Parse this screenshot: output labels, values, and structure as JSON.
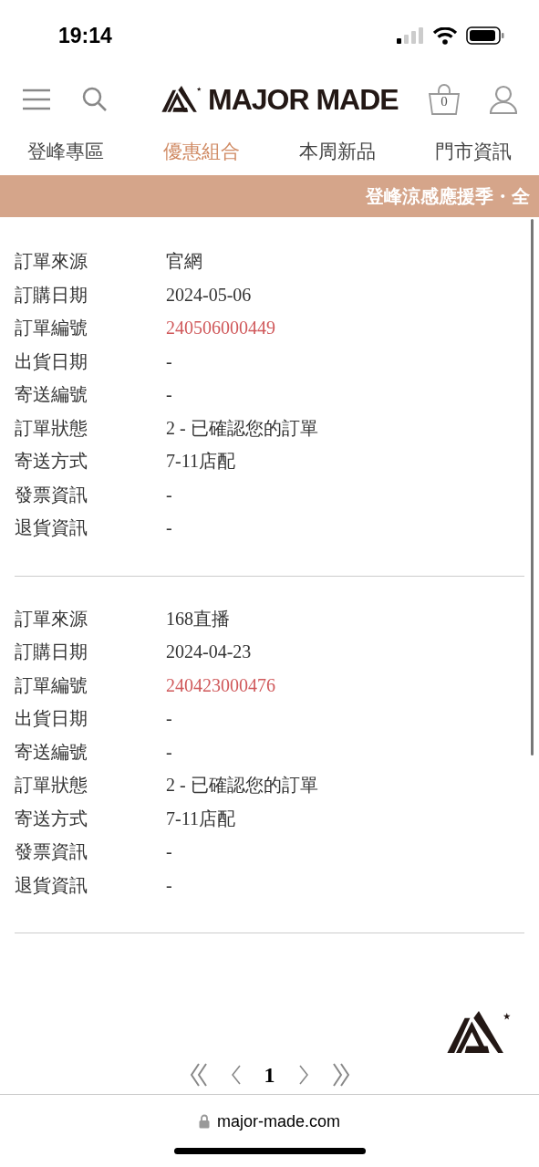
{
  "status_bar": {
    "time": "19:14"
  },
  "header": {
    "logo_text": "MAJOR MADE",
    "cart_count": "0"
  },
  "tabs": [
    {
      "label": "登峰專區",
      "selected": false
    },
    {
      "label": "優惠組合",
      "selected": true
    },
    {
      "label": "本周新品",
      "selected": false
    },
    {
      "label": "門市資訊",
      "selected": false
    }
  ],
  "banner": {
    "text": "登峰涼感應援季・全"
  },
  "orders": [
    {
      "fields": [
        {
          "label": "訂單來源",
          "value": "官網",
          "kind": "text"
        },
        {
          "label": "訂購日期",
          "value": "2024-05-06",
          "kind": "text"
        },
        {
          "label": "訂單編號",
          "value": "240506000449",
          "kind": "link"
        },
        {
          "label": "出貨日期",
          "value": "-",
          "kind": "text"
        },
        {
          "label": "寄送編號",
          "value": "-",
          "kind": "text"
        },
        {
          "label": "訂單狀態",
          "value": "2 - 已確認您的訂單",
          "kind": "text"
        },
        {
          "label": "寄送方式",
          "value": "7-11店配",
          "kind": "text"
        },
        {
          "label": "發票資訊",
          "value": "-",
          "kind": "text"
        },
        {
          "label": "退貨資訊",
          "value": "-",
          "kind": "text"
        }
      ]
    },
    {
      "fields": [
        {
          "label": "訂單來源",
          "value": "168直播",
          "kind": "text"
        },
        {
          "label": "訂購日期",
          "value": "2024-04-23",
          "kind": "text"
        },
        {
          "label": "訂單編號",
          "value": "240423000476",
          "kind": "link"
        },
        {
          "label": "出貨日期",
          "value": "-",
          "kind": "text"
        },
        {
          "label": "寄送編號",
          "value": "-",
          "kind": "text"
        },
        {
          "label": "訂單狀態",
          "value": "2 - 已確認您的訂單",
          "kind": "text"
        },
        {
          "label": "寄送方式",
          "value": "7-11店配",
          "kind": "text"
        },
        {
          "label": "發票資訊",
          "value": "-",
          "kind": "text"
        },
        {
          "label": "退貨資訊",
          "value": "-",
          "kind": "text"
        }
      ]
    }
  ],
  "pagination": {
    "current_page": "1"
  },
  "browser": {
    "url": "major-made.com"
  }
}
